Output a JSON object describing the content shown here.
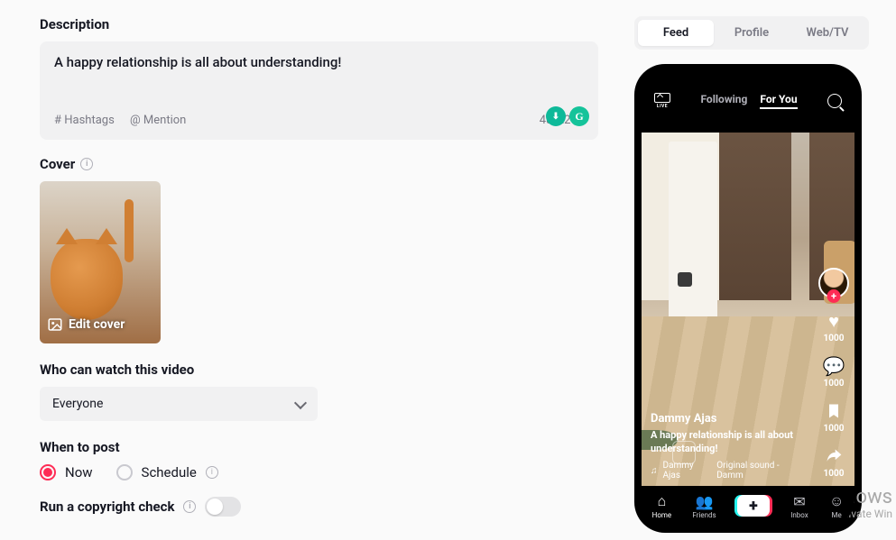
{
  "description": {
    "title": "Description",
    "text": "A happy relationship is all about understanding!",
    "hashtags_label": "#  Hashtags",
    "mention_label": "@  Mention",
    "char_count": "48/2200"
  },
  "cover": {
    "title": "Cover",
    "edit_label": "Edit cover"
  },
  "visibility": {
    "title": "Who can watch this video",
    "selected": "Everyone"
  },
  "when_to_post": {
    "title": "When to post",
    "options": {
      "now": "Now",
      "schedule": "Schedule"
    },
    "selected": "now"
  },
  "copyright": {
    "title": "Run a copyright check",
    "enabled": false
  },
  "preview_tabs": {
    "feed": "Feed",
    "profile": "Profile",
    "webtv": "Web/TV",
    "active": "feed"
  },
  "phone": {
    "top_tabs": {
      "following": "Following",
      "foryou": "For You"
    },
    "user": "Dammy Ajas",
    "caption": "A happy relationship is all about understanding!",
    "sound_author": "Dammy Ajas",
    "sound_name": "Original sound - Damm",
    "action_counts": {
      "like": "1000",
      "comment": "1000",
      "save": "1000",
      "share": "1000"
    },
    "nav": {
      "home": "Home",
      "friends": "Friends",
      "inbox": "Inbox",
      "me": "Me"
    }
  },
  "watermark": {
    "line1": "Activate Windows",
    "line2": "Go to Settings to activate Win"
  }
}
